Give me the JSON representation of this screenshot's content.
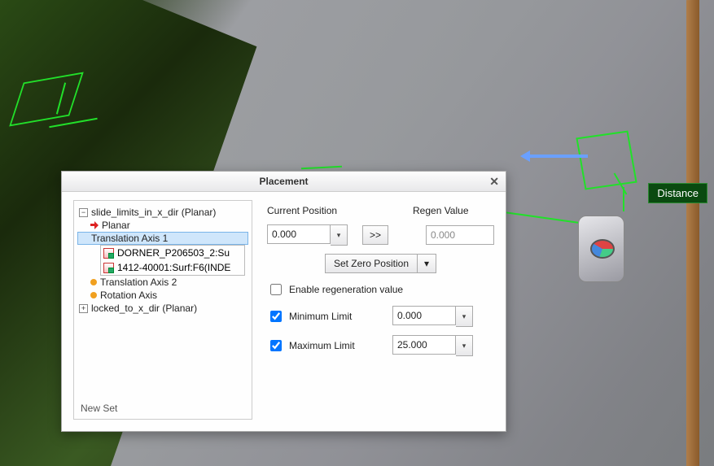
{
  "viewport": {
    "distance_label": "Distance"
  },
  "dialog": {
    "title": "Placement",
    "close_glyph": "✕",
    "tree": {
      "set1": {
        "expander": "−",
        "label": "slide_limits_in_x_dir (Planar)",
        "planar_label": "Planar",
        "axis1_label": "Translation Axis 1",
        "axis1_refs": [
          "DORNER_P206503_2:Su",
          "1412-40001:Surf:F6(INDE"
        ],
        "axis2_label": "Translation Axis 2",
        "rotaxis_label": "Rotation Axis"
      },
      "set2": {
        "expander": "+",
        "label": "locked_to_x_dir (Planar)"
      },
      "new_set_label": "New Set"
    },
    "right": {
      "current_position_label": "Current Position",
      "regen_value_label": "Regen Value",
      "current_position_value": "0.000",
      "step_btn": ">>",
      "regen_value": "0.000",
      "set_zero_label": "Set Zero Position",
      "set_zero_menu_glyph": "▾",
      "enable_regen_label": "Enable regeneration value",
      "enable_regen_checked": false,
      "min_limit_label": "Minimum Limit",
      "min_limit_checked": true,
      "min_limit_value": "0.000",
      "max_limit_label": "Maximum Limit",
      "max_limit_checked": true,
      "max_limit_value": "25.000",
      "spin_glyph": "▾"
    }
  }
}
